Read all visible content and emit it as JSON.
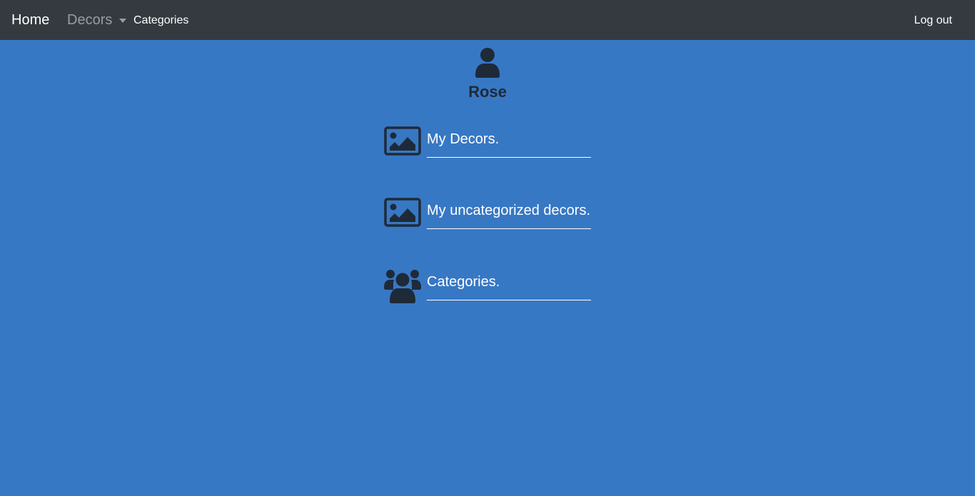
{
  "navbar": {
    "home": "Home",
    "decors": "Decors",
    "categories": "Categories",
    "logout": "Log out"
  },
  "profile": {
    "name": "Rose",
    "icon": "user-icon"
  },
  "menu": [
    {
      "label": "My Decors.",
      "icon": "image-icon"
    },
    {
      "label": "My uncategorized decors.",
      "icon": "image-icon"
    },
    {
      "label": "Categories.",
      "icon": "users-icon"
    }
  ],
  "colors": {
    "background": "#3778c4",
    "navbar": "#343a40",
    "icon": "#1f2a38"
  }
}
